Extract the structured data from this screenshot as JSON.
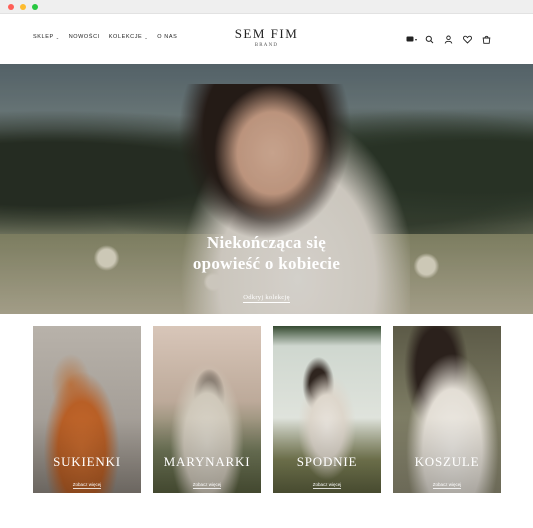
{
  "browser": {
    "controls": [
      "close",
      "minimize",
      "maximize"
    ]
  },
  "header": {
    "nav": [
      {
        "label": "SKLEP",
        "has_dropdown": true
      },
      {
        "label": "NOWOŚCI",
        "has_dropdown": false
      },
      {
        "label": "KOLEKCJE",
        "has_dropdown": true
      },
      {
        "label": "O NAS",
        "has_dropdown": false
      }
    ],
    "logo": {
      "main": "SEM FIM",
      "sub": "BRAND"
    },
    "icons": [
      "currency-icon",
      "search-icon",
      "account-icon",
      "wishlist-icon",
      "cart-icon"
    ]
  },
  "hero": {
    "title_line1": "Niekończąca się",
    "title_line2": "opowieść o kobiecie",
    "cta": "Odkryj kolekcję"
  },
  "categories": [
    {
      "label": "SUKIENKI",
      "more": "Zobacz więcej"
    },
    {
      "label": "MARYNARKI",
      "more": "Zobacz więcej"
    },
    {
      "label": "SPODNIE",
      "more": "Zobacz więcej"
    },
    {
      "label": "KOSZULE",
      "more": "Zobacz więcej"
    }
  ],
  "colors": {
    "accent": "#222222",
    "background": "#ffffff"
  }
}
